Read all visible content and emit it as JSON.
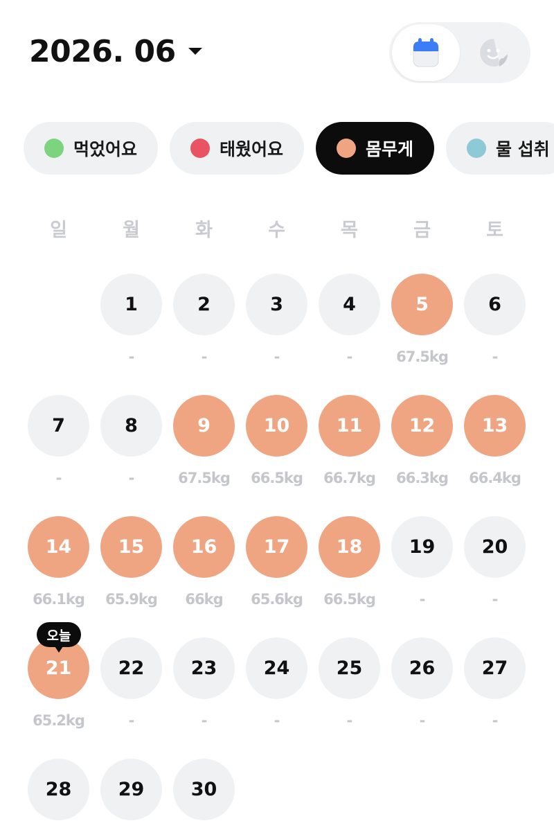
{
  "header": {
    "month_label": "2026. 06",
    "view_toggle": {
      "calendar_icon": "calendar-icon",
      "face_icon": "smiley-sticker-icon",
      "active": "calendar"
    }
  },
  "filters": [
    {
      "label": "먹었어요",
      "color": "#7cd47e",
      "active": false
    },
    {
      "label": "태웠어요",
      "color": "#e85464",
      "active": false
    },
    {
      "label": "몸무게",
      "color": "#f0a582",
      "active": true
    },
    {
      "label": "물 섭취",
      "color": "#8ec9d6",
      "active": false
    }
  ],
  "weekdays": [
    "일",
    "월",
    "화",
    "수",
    "목",
    "금",
    "토"
  ],
  "calendar": {
    "first_weekday_index": 1,
    "today_badge": "오늘",
    "logged_color": "#f0a582",
    "days": [
      {
        "day": "1",
        "value": "-",
        "logged": false
      },
      {
        "day": "2",
        "value": "-",
        "logged": false
      },
      {
        "day": "3",
        "value": "-",
        "logged": false
      },
      {
        "day": "4",
        "value": "-",
        "logged": false
      },
      {
        "day": "5",
        "value": "67.5kg",
        "logged": true
      },
      {
        "day": "6",
        "value": "-",
        "logged": false
      },
      {
        "day": "7",
        "value": "-",
        "logged": false
      },
      {
        "day": "8",
        "value": "-",
        "logged": false
      },
      {
        "day": "9",
        "value": "67.5kg",
        "logged": true
      },
      {
        "day": "10",
        "value": "66.5kg",
        "logged": true
      },
      {
        "day": "11",
        "value": "66.7kg",
        "logged": true
      },
      {
        "day": "12",
        "value": "66.3kg",
        "logged": true
      },
      {
        "day": "13",
        "value": "66.4kg",
        "logged": true
      },
      {
        "day": "14",
        "value": "66.1kg",
        "logged": true
      },
      {
        "day": "15",
        "value": "65.9kg",
        "logged": true
      },
      {
        "day": "16",
        "value": "66kg",
        "logged": true
      },
      {
        "day": "17",
        "value": "65.6kg",
        "logged": true
      },
      {
        "day": "18",
        "value": "66.5kg",
        "logged": true
      },
      {
        "day": "19",
        "value": "-",
        "logged": false
      },
      {
        "day": "20",
        "value": "-",
        "logged": false
      },
      {
        "day": "21",
        "value": "65.2kg",
        "logged": true,
        "today": true
      },
      {
        "day": "22",
        "value": "-",
        "logged": false
      },
      {
        "day": "23",
        "value": "-",
        "logged": false
      },
      {
        "day": "24",
        "value": "-",
        "logged": false
      },
      {
        "day": "25",
        "value": "-",
        "logged": false
      },
      {
        "day": "26",
        "value": "-",
        "logged": false
      },
      {
        "day": "27",
        "value": "-",
        "logged": false
      },
      {
        "day": "28",
        "value": "",
        "logged": false
      },
      {
        "day": "29",
        "value": "",
        "logged": false
      },
      {
        "day": "30",
        "value": "",
        "logged": false
      }
    ]
  }
}
